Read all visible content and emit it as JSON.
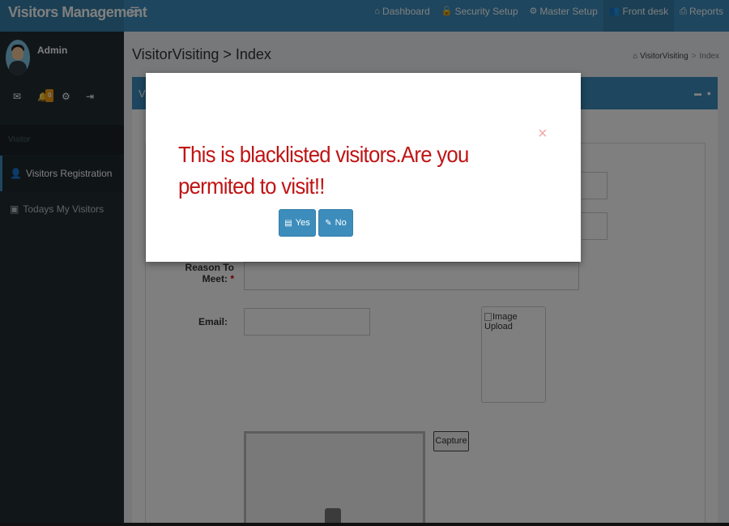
{
  "app": {
    "title": "Visitors Management"
  },
  "topnav": {
    "menu_icon": "☰",
    "items": [
      {
        "label": "Dashboard",
        "icon": "home-icon",
        "glyph": "⌂"
      },
      {
        "label": "Security Setup",
        "icon": "unlock-icon",
        "glyph": "🔓"
      },
      {
        "label": "Master Setup",
        "icon": "cogs-icon",
        "glyph": "⚙"
      },
      {
        "label": "Front desk",
        "icon": "users-icon",
        "glyph": "👥"
      },
      {
        "label": "Reports",
        "icon": "print-icon",
        "glyph": "⎙"
      }
    ],
    "active": "Front desk"
  },
  "sidebar": {
    "username": "Admin",
    "notification_count": "0",
    "icons": {
      "mail": "✉",
      "bell": "🔔",
      "gear": "⚙",
      "logout": "⇥"
    },
    "section_header": "Visitor",
    "items": [
      {
        "label": "Visitors Registration",
        "glyph": "👤"
      },
      {
        "label": "Todays My Visitors",
        "glyph": "▣"
      }
    ]
  },
  "page": {
    "title": "VisitorVisiting > Index",
    "breadcrumb": {
      "home": "VisitorVisiting",
      "sep": ">",
      "current": "Index",
      "glyph": "⌂"
    },
    "box_title": "Vi",
    "tools": {
      "minimize": "▬",
      "comment": "●"
    }
  },
  "form": {
    "reason_label": "Reason To Meet:",
    "required_mark": "*",
    "email_label": "Email:",
    "image_upload_alt": "Image Upload",
    "capture_label": "Capture"
  },
  "modal": {
    "message": "This is blacklisted visitors.Are you permited to visit!!",
    "close": "×",
    "yes_label": "Yes",
    "no_label": "No",
    "yes_glyph": "💾",
    "no_glyph": "✎"
  },
  "colors": {
    "accent": "#3c8dbc",
    "sidebar": "#222d32",
    "warning_text": "#c01414",
    "badge": "#f39c12"
  }
}
